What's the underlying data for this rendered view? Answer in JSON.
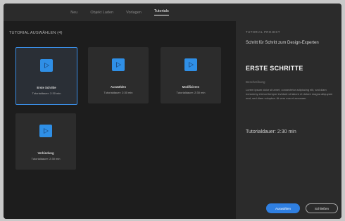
{
  "tabs": [
    {
      "label": "Neu",
      "active": false
    },
    {
      "label": "Objekt Laden",
      "active": false
    },
    {
      "label": "Vorlagen",
      "active": false
    },
    {
      "label": "Tutorials",
      "active": true
    }
  ],
  "main": {
    "section_title": "TUTORIAL AUSWÄHLEN (4)",
    "cards": [
      {
        "title": "Erste Schritte",
        "meta": "Tutorialdauer: 2:30 min",
        "selected": true,
        "icon": "play-icon"
      },
      {
        "title": "Auswählen",
        "meta": "Tutorialdauer: 2:30 min",
        "selected": false,
        "icon": "play-icon"
      },
      {
        "title": "Modifizieren",
        "meta": "Tutorialdauer: 2:30 min",
        "selected": false,
        "icon": "play-icon"
      },
      {
        "title": "Verbindung",
        "meta": "Tutorialdauer: 2:30 min",
        "selected": false,
        "icon": "play-icon"
      }
    ]
  },
  "side": {
    "eyebrow": "TUTORIAL PROJEKT",
    "lead": "Schritt für Schritt zum Design-Experten",
    "heading": "ERSTE SCHRITTE",
    "sublabel": "Beschreibung",
    "description": "Lorem ipsum dolor sit amet, consectetur adipiscing elit, sed diam nonummy eirmod tempor invidunt ut labore et dolore magna aliquyam erat, sed diam voluptua. At vero eos et accusam.",
    "duration": "Tutorialdauer: 2:30 min"
  },
  "buttons": {
    "primary": "Auswählen",
    "secondary": "Schließen"
  },
  "colors": {
    "accent": "#2f8fe6",
    "background": "#1d1d1d",
    "panel": "#2b2b2b"
  }
}
